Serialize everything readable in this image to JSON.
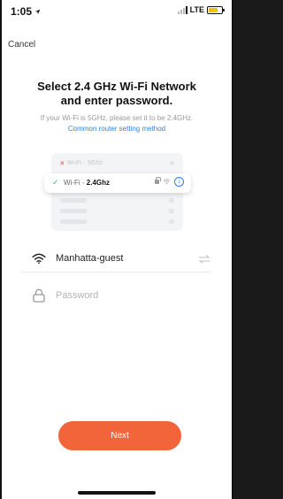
{
  "status_bar": {
    "time": "1:05",
    "network": "LTE"
  },
  "nav": {
    "cancel_label": "Cancel"
  },
  "header": {
    "title_line1": "Select 2.4 GHz Wi-Fi Network",
    "title_line2": "and enter password.",
    "subtitle": "If your Wi-Fi is 5GHz, please set it to be 2.4GHz.",
    "link": "Common router setting method"
  },
  "illustration": {
    "row1_prefix": "Wi-Fi - ",
    "row1_band": "5Ghz",
    "card_prefix": "Wi-Fi - ",
    "card_band": "2.4Ghz"
  },
  "form": {
    "network_value": "Manhatta-guest",
    "password_placeholder": "Password"
  },
  "actions": {
    "next_label": "Next"
  },
  "colors": {
    "accent": "#f2643a",
    "link": "#2f7fe0",
    "check": "#3fbf5c",
    "error": "#f06a6a"
  },
  "icons": {
    "location": "location-arrow-icon",
    "wifi": "wifi-icon",
    "lock": "lock-icon",
    "swap": "swap-arrows-icon",
    "info": "info-icon"
  }
}
